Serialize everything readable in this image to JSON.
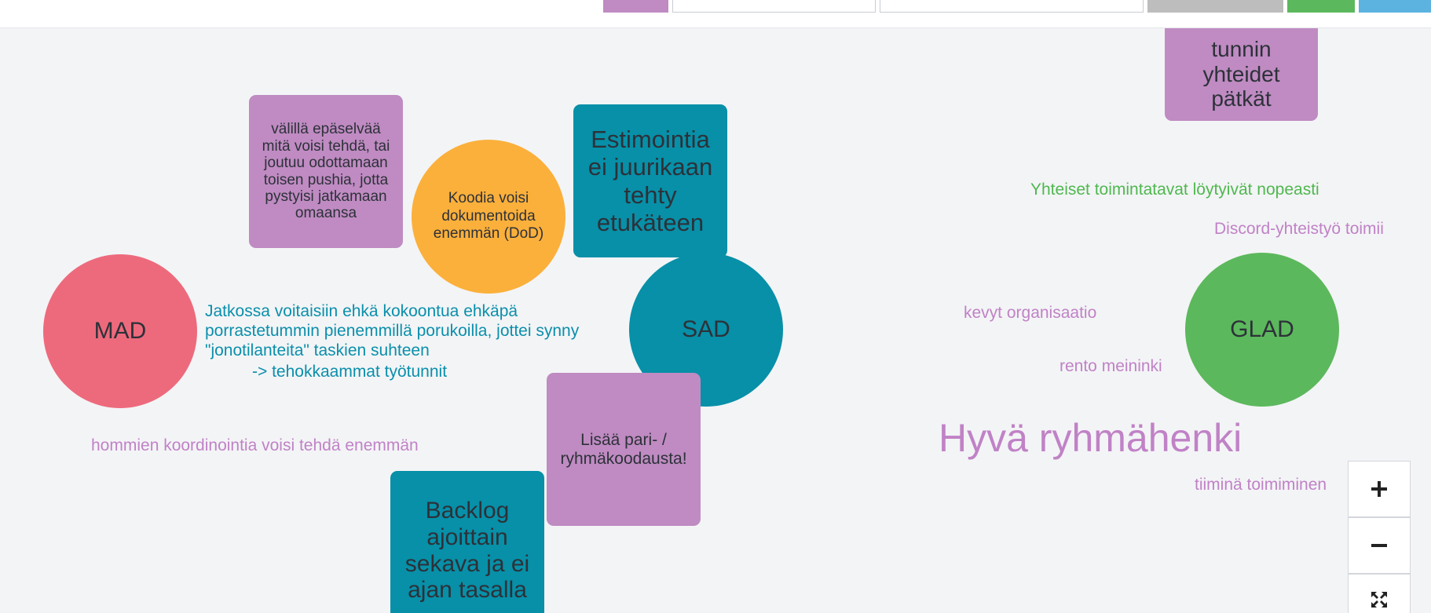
{
  "notes": {
    "epaselvaa": "välillä epäselvää mitä voisi tehdä, tai joutuu odottamaan toisen pushia, jotta pystyisi jatkamaan omaansa",
    "koodia": "Koodia voisi dokumentoida enemmän (DoD)",
    "estimointia": "Estimointia ei juurikaan tehty etukäteen",
    "pari": "Lisää pari- / ryhmäkoodausta!",
    "backlog": "Backlog ajoittain sekava ja ei ajan tasalla",
    "yhteiset_line1": "tunnin",
    "yhteiset_line2": "yhteidet",
    "yhteiset_line3": "pätkät"
  },
  "circles": {
    "mad": "MAD",
    "sad": "SAD",
    "glad": "GLAD"
  },
  "texts": {
    "jatkossa1": "Jatkossa voitaisiin ehkä kokoontua ehkäpä",
    "jatkossa2": "porrastetummin pienemmillä porukoilla, jottei synny",
    "jatkossa3": "\"jonotilanteita\" taskien suhteen",
    "jatkossa4": "-> tehokkaammat työtunnit",
    "koordinointi": "hommien koordinointia voisi tehdä enemmän",
    "toimintatavat": "Yhteiset toimintatavat löytyivät nopeasti",
    "discord": "Discord-yhteistyö toimii",
    "kevyt": "kevyt organisaatio",
    "rento": "rento meininki",
    "ryhmahenki": "Hyvä ryhmähenki",
    "tiimina": "tiiminä toimiminen"
  },
  "colors": {
    "purple": "#bf8bc2",
    "teal": "#0790a8",
    "orange": "#fbb03b",
    "red": "#ed6a7c",
    "green": "#5cb85c",
    "blue": "#5cb3e0",
    "gray": "#bdbdbd",
    "text_teal": "#0a8fab",
    "text_purple": "#c082c6",
    "text_green": "#4fb84f"
  },
  "icons": {
    "zoom_in": "plus-icon",
    "zoom_out": "minus-icon",
    "fit": "fullscreen-icon"
  }
}
